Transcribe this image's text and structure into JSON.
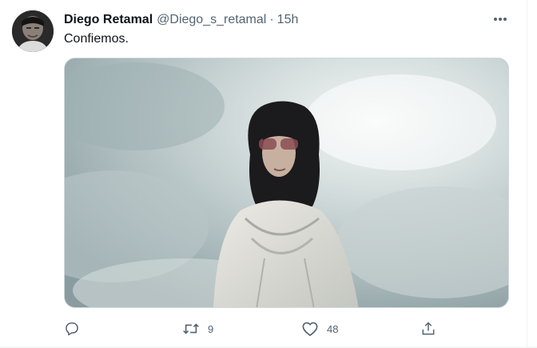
{
  "tweet": {
    "author_name": "Diego Retamal",
    "author_handle": "@Diego_s_retamal",
    "separator": "·",
    "time": "15h",
    "text": "Confiemos."
  },
  "actions": {
    "reply_count": "",
    "retweet_count": "9",
    "like_count": "48"
  },
  "icons": {
    "more": "more-horizontal-icon",
    "reply": "reply-icon",
    "retweet": "retweet-icon",
    "like": "heart-icon",
    "share": "share-icon"
  },
  "colors": {
    "text": "#0f1419",
    "secondary": "#536471",
    "border": "#cfd9de"
  }
}
